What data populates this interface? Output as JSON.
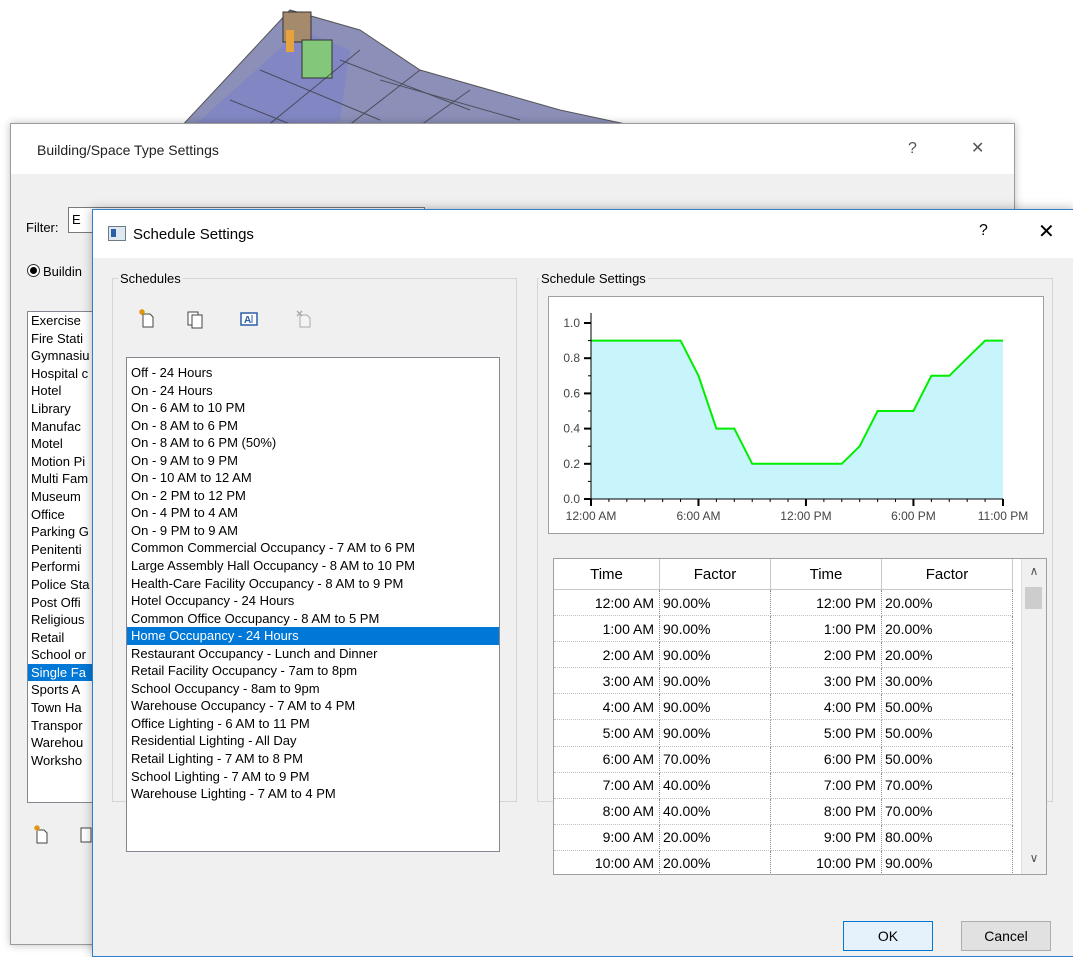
{
  "background_dialog": {
    "title": "Building/Space Type Settings",
    "help_symbol": "?",
    "close_symbol": "✕",
    "filter_label": "Filter:",
    "filter_value": "E",
    "radio_label": "Buildin",
    "items": [
      "Exercise",
      "Fire Stati",
      "Gymnasiu",
      "Hospital c",
      "Hotel",
      "Library",
      "Manufac",
      "Motel",
      "Motion Pi",
      "Multi Fam",
      "Museum",
      "Office",
      "Parking G",
      "Penitenti",
      "Performi",
      "Police Sta",
      "Post Offi",
      "Religious",
      "Retail",
      "School or",
      "Single Fa",
      "Sports A",
      "Town Ha",
      "Transpor",
      "Warehou",
      "Worksho"
    ],
    "selected_index": 20
  },
  "dialog": {
    "title": "Schedule Settings",
    "help_symbol": "?",
    "close_symbol": "✕"
  },
  "schedules_group": {
    "label": "Schedules",
    "toolbar": [
      "new-schedule-icon",
      "duplicate-icon",
      "rename-icon",
      "delete-icon"
    ],
    "items": [
      "Off - 24 Hours",
      "On - 24 Hours",
      "On - 6 AM to 10 PM",
      "On - 8 AM to 6 PM",
      "On - 8 AM to 6 PM (50%)",
      "On - 9 AM to 9 PM",
      "On - 10 AM to 12 AM",
      "On - 2 PM to 12 PM",
      "On - 4 PM to 4 AM",
      "On - 9 PM to 9 AM",
      "Common Commercial Occupancy - 7 AM to 6 PM",
      "Large Assembly Hall Occupancy - 8 AM to 10 PM",
      "Health-Care Facility Occupancy - 8 AM to 9 PM",
      "Hotel Occupancy - 24 Hours",
      "Common Office Occupancy - 8 AM to 5 PM",
      "Home Occupancy - 24 Hours",
      "Restaurant Occupancy - Lunch and Dinner",
      "Retail Facility Occupancy - 7am to 8pm",
      "School Occupancy - 8am to 9pm",
      "Warehouse Occupancy - 7 AM to 4 PM",
      "Office Lighting - 6 AM to 11 PM",
      "Residential Lighting - All Day",
      "Retail Lighting - 7 AM to 8 PM",
      "School Lighting - 7 AM to 9 PM",
      "Warehouse Lighting - 7 AM to 4 PM"
    ],
    "selected_index": 15
  },
  "settings_group": {
    "label": "Schedule Settings"
  },
  "chart_data": {
    "type": "area",
    "x": [
      0,
      1,
      2,
      3,
      4,
      5,
      6,
      7,
      8,
      9,
      10,
      11,
      12,
      13,
      14,
      15,
      16,
      17,
      18,
      19,
      20,
      21,
      22,
      23
    ],
    "values": [
      0.9,
      0.9,
      0.9,
      0.9,
      0.9,
      0.9,
      0.7,
      0.4,
      0.4,
      0.2,
      0.2,
      0.2,
      0.2,
      0.2,
      0.2,
      0.3,
      0.5,
      0.5,
      0.5,
      0.7,
      0.7,
      0.8,
      0.9,
      0.9
    ],
    "x_tick_labels": [
      "12:00 AM",
      "6:00 AM",
      "12:00 PM",
      "6:00 PM",
      "11:00 PM"
    ],
    "x_tick_hours": [
      0,
      6,
      12,
      18,
      23
    ],
    "y_tick_labels": [
      "0.0",
      "0.2",
      "0.4",
      "0.6",
      "0.8",
      "1.0"
    ],
    "ylim": [
      0,
      1.0
    ],
    "line_color": "#00ee00",
    "fill_color": "#c8f4fb",
    "grid": false
  },
  "table": {
    "headers": [
      "Time",
      "Factor",
      "Time",
      "Factor"
    ],
    "rows": [
      [
        "12:00 AM",
        "90.00%",
        "12:00 PM",
        "20.00%"
      ],
      [
        "1:00 AM",
        "90.00%",
        "1:00 PM",
        "20.00%"
      ],
      [
        "2:00 AM",
        "90.00%",
        "2:00 PM",
        "20.00%"
      ],
      [
        "3:00 AM",
        "90.00%",
        "3:00 PM",
        "30.00%"
      ],
      [
        "4:00 AM",
        "90.00%",
        "4:00 PM",
        "50.00%"
      ],
      [
        "5:00 AM",
        "90.00%",
        "5:00 PM",
        "50.00%"
      ],
      [
        "6:00 AM",
        "70.00%",
        "6:00 PM",
        "50.00%"
      ],
      [
        "7:00 AM",
        "40.00%",
        "7:00 PM",
        "70.00%"
      ],
      [
        "8:00 AM",
        "40.00%",
        "8:00 PM",
        "70.00%"
      ],
      [
        "9:00 AM",
        "20.00%",
        "9:00 PM",
        "80.00%"
      ],
      [
        "10:00 AM",
        "20.00%",
        "10:00 PM",
        "90.00%"
      ]
    ]
  },
  "buttons": {
    "ok": "OK",
    "cancel": "Cancel"
  },
  "colors": {
    "selection": "#0078d7",
    "dialog_border": "#2f7fd0"
  }
}
